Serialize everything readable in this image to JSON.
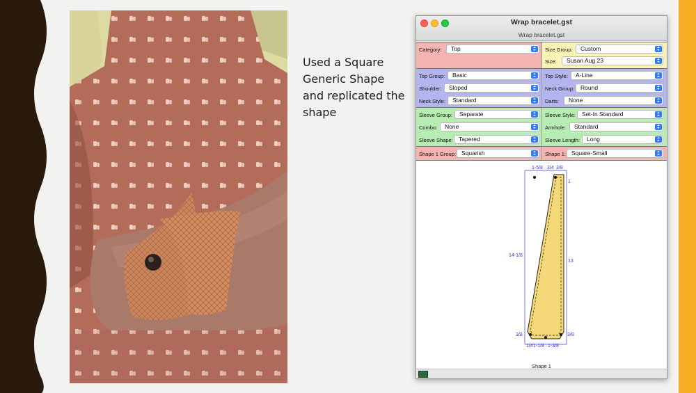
{
  "slide": {
    "caption": "Used a Square Generic Shape and replicated the shape",
    "accent_color": "#f6ad23",
    "deco_color": "#2a1a0c"
  },
  "window": {
    "title": "Wrap bracelet.gst",
    "subtitle": "Wrap bracelet.gst",
    "status_icon": "pattern-thumbnail-icon"
  },
  "panels": {
    "category": {
      "label": "Category:",
      "value": "Top"
    },
    "size_group": {
      "label": "Size Group:",
      "value": "Custom"
    },
    "size": {
      "label": "Size:",
      "value": "Susan Aug 23"
    },
    "top_group": {
      "label": "Top Group:",
      "value": "Basic"
    },
    "top_style": {
      "label": "Top Style:",
      "value": "A-Line"
    },
    "shoulder": {
      "label": "Shoulder:",
      "value": "Sloped"
    },
    "neck_group": {
      "label": "Neck Group:",
      "value": "Round"
    },
    "neck_style": {
      "label": "Neck Style:",
      "value": "Standard"
    },
    "darts": {
      "label": "Darts:",
      "value": "None"
    },
    "sleeve_group": {
      "label": "Sleeve Group:",
      "value": "Separate"
    },
    "sleeve_style": {
      "label": "Sleeve Style:",
      "value": "Set-In Standard"
    },
    "combo": {
      "label": "Combo:",
      "value": "None"
    },
    "armhole": {
      "label": "Armhole:",
      "value": "Standard"
    },
    "sleeve_shape": {
      "label": "Sleeve Shape:",
      "value": "Tapered"
    },
    "sleeve_length": {
      "label": "Sleeve Length:",
      "value": "Long"
    },
    "shape1_group": {
      "label": "Shape 1 Group:",
      "value": "Squarish"
    },
    "shape1": {
      "label": "Shape 1:",
      "value": "Square-Small"
    }
  },
  "pattern": {
    "name": "Shape 1",
    "dims": {
      "top_left": "1-5/8",
      "top_right": "3/4",
      "top_far": "3/8",
      "right_small": "1",
      "left_height": "14-1/8",
      "right_height": "13",
      "bottom_left_side": "3/8",
      "bottom_right_side": "3/8",
      "bottom_1": "1/4",
      "bottom_2": "1-1/8",
      "bottom_3": "1-3/8"
    },
    "fill_color": "#f5d978",
    "dim_color": "#3a3ad0"
  }
}
